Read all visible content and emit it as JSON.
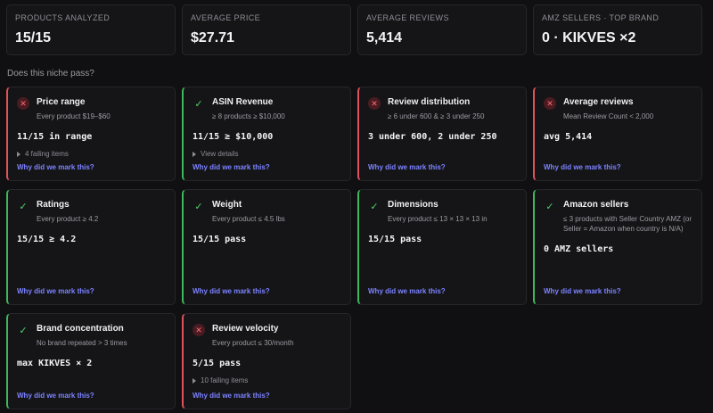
{
  "stats": [
    {
      "label": "PRODUCTS ANALYZED",
      "value": "15/15"
    },
    {
      "label": "AVERAGE PRICE",
      "value": "$27.71"
    },
    {
      "label": "AVERAGE REVIEWS",
      "value": "5,414"
    },
    {
      "label": "AMZ SELLERS · TOP BRAND",
      "value": "0 · KIKVES ×2"
    }
  ],
  "section_title": "Does this niche pass?",
  "why_label": "Why did we mark this?",
  "colors": {
    "fail": "#e0525c",
    "pass": "#3fb85c",
    "link": "#7c83ff"
  },
  "cards": [
    {
      "status": "fail",
      "title": "Price range",
      "sub": "Every product $19–$60",
      "value": "11/15 in range",
      "detail": "4 failing items"
    },
    {
      "status": "pass",
      "title": "ASIN Revenue",
      "sub": "≥ 8 products ≥ $10,000",
      "value": "11/15 ≥ $10,000",
      "detail": "View details"
    },
    {
      "status": "fail",
      "title": "Review distribution",
      "sub": "≥ 6 under 600 & ≥ 3 under 250",
      "value": "3 under 600, 2 under 250",
      "detail": ""
    },
    {
      "status": "fail",
      "title": "Average reviews",
      "sub": "Mean Review Count < 2,000",
      "value": "avg 5,414",
      "detail": ""
    },
    {
      "status": "pass",
      "title": "Ratings",
      "sub": "Every product ≥ 4.2",
      "value": "15/15 ≥ 4.2",
      "detail": ""
    },
    {
      "status": "pass",
      "title": "Weight",
      "sub": "Every product ≤ 4.5 lbs",
      "value": "15/15 pass",
      "detail": ""
    },
    {
      "status": "pass",
      "title": "Dimensions",
      "sub": "Every product ≤ 13 × 13 × 13 in",
      "value": "15/15 pass",
      "detail": ""
    },
    {
      "status": "pass",
      "title": "Amazon sellers",
      "sub": "≤ 3 products with Seller Country AMZ (or Seller = Amazon when country is N/A)",
      "value": "0 AMZ sellers",
      "detail": ""
    },
    {
      "status": "pass",
      "title": "Brand concentration",
      "sub": "No brand repeated > 3 times",
      "value": "max KIKVES × 2",
      "detail": ""
    },
    {
      "status": "fail",
      "title": "Review velocity",
      "sub": "Every product ≤ 30/month",
      "value": "5/15 pass",
      "detail": "10 failing items"
    }
  ]
}
